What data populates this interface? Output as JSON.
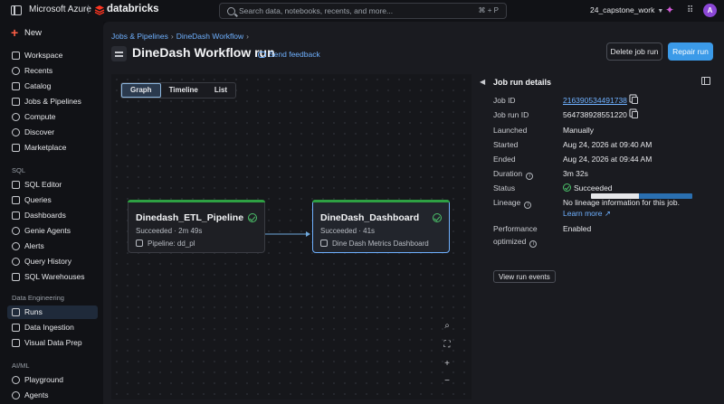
{
  "topbar": {
    "platform": "Microsoft Azure",
    "product": "databricks",
    "search_placeholder": "Search data, notebooks, recents, and more...",
    "search_shortcut": "⌘ + P",
    "workspace": "24_capstone_work",
    "avatar_initial": "A"
  },
  "sidebar": {
    "new_label": "New",
    "items_top": [
      {
        "label": "Workspace",
        "icon": "folder-icon"
      },
      {
        "label": "Recents",
        "icon": "clock-icon"
      },
      {
        "label": "Catalog",
        "icon": "catalog-icon"
      },
      {
        "label": "Jobs & Pipelines",
        "icon": "workflow-icon"
      },
      {
        "label": "Compute",
        "icon": "cloud-icon"
      },
      {
        "label": "Discover",
        "icon": "compass-icon"
      },
      {
        "label": "Marketplace",
        "icon": "store-icon"
      }
    ],
    "sql_header": "SQL",
    "items_sql": [
      {
        "label": "SQL Editor",
        "icon": "editor-icon"
      },
      {
        "label": "Queries",
        "icon": "query-icon"
      },
      {
        "label": "Dashboards",
        "icon": "dashboard-icon"
      },
      {
        "label": "Genie Agents",
        "icon": "genie-icon"
      },
      {
        "label": "Alerts",
        "icon": "bell-icon"
      },
      {
        "label": "Query History",
        "icon": "history-icon"
      },
      {
        "label": "SQL Warehouses",
        "icon": "warehouse-icon"
      }
    ],
    "de_header": "Data Engineering",
    "items_de": [
      {
        "label": "Runs",
        "icon": "runs-icon"
      },
      {
        "label": "Data Ingestion",
        "icon": "ingestion-icon"
      },
      {
        "label": "Visual Data Prep",
        "icon": "prep-icon"
      }
    ],
    "ml_header": "AI/ML",
    "items_ml": [
      {
        "label": "Playground",
        "icon": "playground-icon"
      },
      {
        "label": "Agents",
        "icon": "agents-icon"
      }
    ]
  },
  "header": {
    "breadcrumb": [
      "Jobs & Pipelines",
      "DineDash Workflow"
    ],
    "title": "DineDash Workflow run",
    "feedback": "Send feedback",
    "delete_label": "Delete job run",
    "repair_label": "Repair run"
  },
  "view_tabs": [
    "Graph",
    "Timeline",
    "List"
  ],
  "tasks": [
    {
      "name": "Dinedash_ETL_Pipeline",
      "status": "Succeeded · 2m 49s",
      "sub": "Pipeline:  dd_pl",
      "sub_icon": "pipeline-icon"
    },
    {
      "name": "DineDash_Dashboard",
      "status": "Succeeded · 41s",
      "sub": "Dine Dash Metrics Dashboard",
      "sub_icon": "dashboard-icon"
    }
  ],
  "details": {
    "title": "Job run details",
    "job_id_label": "Job ID",
    "job_id": "216390534491738",
    "run_id_label": "Job run ID",
    "run_id": "564738928551220",
    "launched_label": "Launched",
    "launched": "Manually",
    "started_label": "Started",
    "started": "Aug 24, 2026 at 09:40 AM",
    "ended_label": "Ended",
    "ended": "Aug 24, 2026 at 09:44 AM",
    "duration_label": "Duration",
    "duration": "3m 32s",
    "duration_fraction": 0.47,
    "status_label": "Status",
    "status": "Succeeded",
    "lineage_label": "Lineage",
    "lineage": "No lineage information for this job.",
    "learn_more": "Learn more",
    "perf_label_1": "Performance",
    "perf_label_2": "optimized",
    "perf": "Enabled",
    "view_events": "View run events"
  },
  "colors": {
    "accent": "#3b9ae8",
    "success": "#4cc26a",
    "brand": "#ff5f46"
  }
}
